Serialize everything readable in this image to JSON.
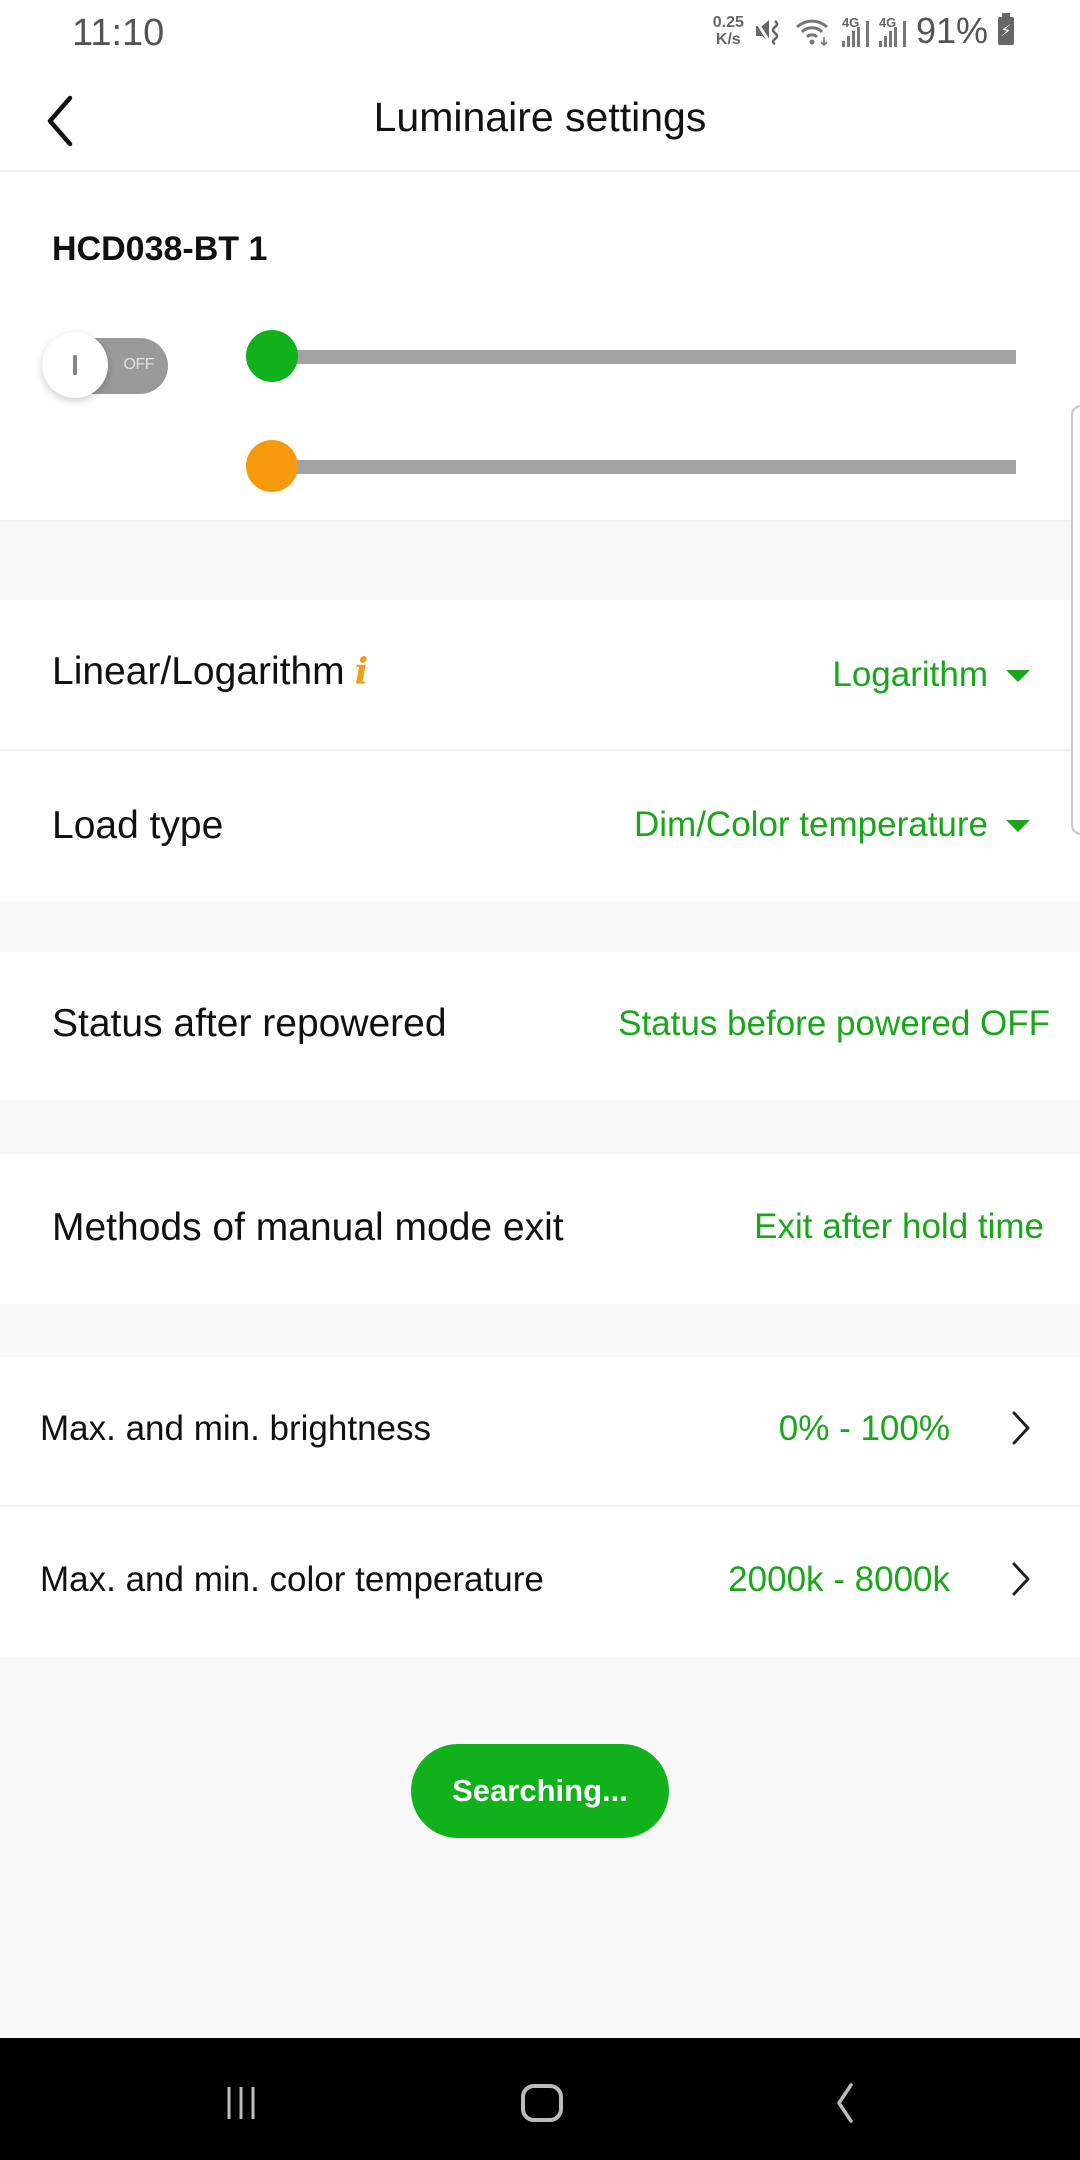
{
  "status_bar": {
    "time": "11:10",
    "net_speed_value": "0.25",
    "net_speed_unit": "K/s",
    "icons": [
      "mute-vibrate-icon",
      "wifi-icon",
      "signal-4g-icon",
      "signal-4g-icon",
      "battery-charging-icon"
    ],
    "signal_label_1": "4G",
    "signal_label_2": "4G",
    "battery_percent": "91%"
  },
  "header": {
    "title": "Luminaire settings",
    "back_icon": "chevron-left-icon"
  },
  "device": {
    "name": "HCD038-BT 1",
    "power_state_label": "OFF",
    "power_on": false,
    "brightness_slider": {
      "value_fraction": 0,
      "color": "#11b11b"
    },
    "cct_slider": {
      "value_fraction": 0,
      "color": "#f7990c"
    }
  },
  "settings": {
    "linear_log": {
      "label": "Linear/Logarithm",
      "info_icon": "i",
      "value": "Logarithm"
    },
    "load_type": {
      "label": "Load type",
      "value": "Dim/Color temperature"
    },
    "status_after_repowered": {
      "label": "Status after repowered",
      "value": "Status before powered OFF"
    },
    "manual_mode_exit": {
      "label": "Methods of manual mode exit",
      "value": "Exit after hold time"
    },
    "brightness_range": {
      "label": "Max. and min. brightness",
      "value": "0% - 100%"
    },
    "cct_range": {
      "label": "Max. and min. color temperature",
      "value": "2000k - 8000k"
    }
  },
  "search_button": {
    "label": "Searching..."
  },
  "colors": {
    "accent_green": "#1aa61a",
    "button_green": "#11b11b",
    "info_orange": "#f0a020",
    "slider_orange": "#f7990c",
    "track_gray": "#a2a2a2"
  },
  "nav_bar": {
    "recent_icon": "recent-apps-icon",
    "home_icon": "home-icon",
    "back_icon": "back-icon"
  }
}
